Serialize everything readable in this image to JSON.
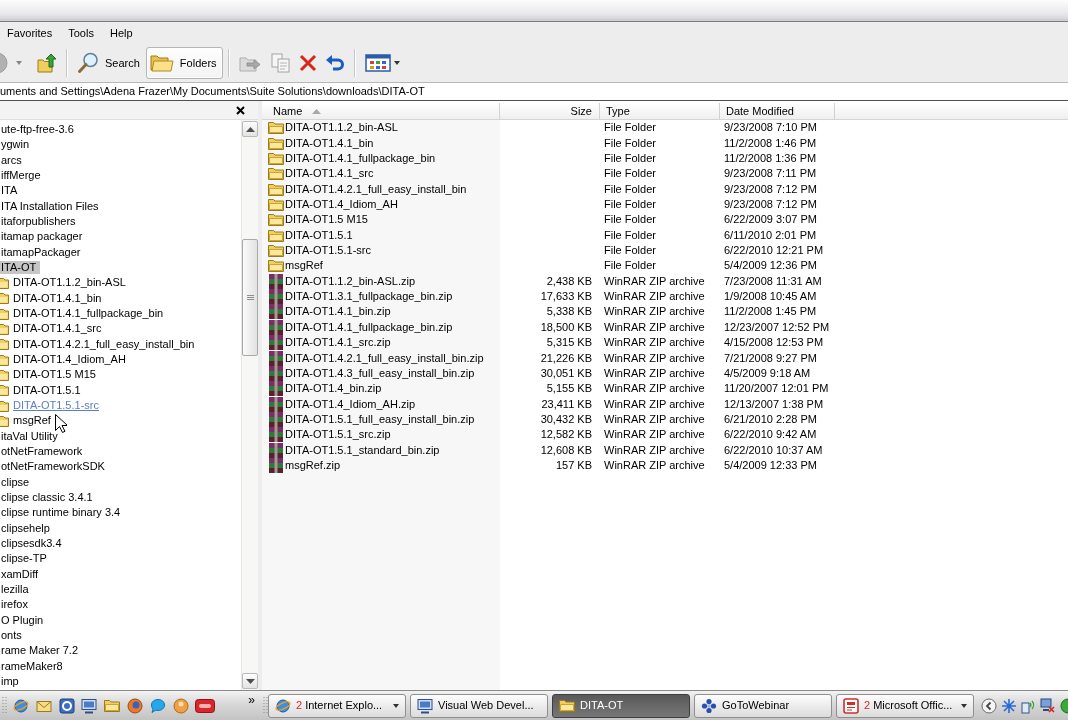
{
  "menu": [
    "Favorites",
    "Tools",
    "Help"
  ],
  "toolbar": [
    {
      "kind": "back",
      "disabled": true,
      "selected": false
    },
    {
      "kind": "history",
      "disabled": true,
      "selected": false
    },
    {
      "kind": "up",
      "disabled": false,
      "selected": false
    },
    {
      "kind": "search",
      "label": "Search",
      "disabled": false,
      "selected": false
    },
    {
      "kind": "folders",
      "label": "Folders",
      "disabled": false,
      "selected": true
    },
    {
      "kind": "move",
      "disabled": true,
      "selected": false
    },
    {
      "kind": "copy",
      "disabled": true,
      "selected": false
    },
    {
      "kind": "delete",
      "disabled": false,
      "selected": false
    },
    {
      "kind": "undo",
      "disabled": false,
      "selected": false
    },
    {
      "kind": "views",
      "disabled": false,
      "selected": false
    }
  ],
  "address": {
    "value": "uments and Settings\\Adena Frazer\\My Documents\\Suite Solutions\\downloads\\DITA-OT"
  },
  "folder_tree": {
    "items": [
      {
        "label": "ute-ftp-free-3.6",
        "selected": false
      },
      {
        "label": "ygwin",
        "selected": false
      },
      {
        "label": "arcs",
        "selected": false
      },
      {
        "label": "iffMerge",
        "selected": false
      },
      {
        "label": "ITA",
        "selected": false
      },
      {
        "label": "ITA Installation Files",
        "selected": false
      },
      {
        "label": "itaforpublishers",
        "selected": false
      },
      {
        "label": "itamap packager",
        "selected": false
      },
      {
        "label": "itamapPackager",
        "selected": false
      },
      {
        "label": "ITA-OT",
        "selected": true,
        "children": [
          {
            "label": "DITA-OT1.1.2_bin-ASL",
            "selected": false,
            "hovered": false
          },
          {
            "label": "DITA-OT1.4.1_bin",
            "selected": false,
            "hovered": false
          },
          {
            "label": "DITA-OT1.4.1_fullpackage_bin",
            "selected": false,
            "hovered": false
          },
          {
            "label": "DITA-OT1.4.1_src",
            "selected": false,
            "hovered": false
          },
          {
            "label": "DITA-OT1.4.2.1_full_easy_install_bin",
            "selected": false,
            "hovered": false
          },
          {
            "label": "DITA-OT1.4_Idiom_AH",
            "selected": false,
            "hovered": false
          },
          {
            "label": "DITA-OT1.5 M15",
            "selected": false,
            "hovered": false
          },
          {
            "label": "DITA-OT1.5.1",
            "selected": false,
            "hovered": false
          },
          {
            "label": "DITA-OT1.5.1-src",
            "selected": false,
            "hovered": true
          },
          {
            "label": "msgRef",
            "selected": false,
            "hovered": false
          }
        ]
      },
      {
        "label": "itaVal Utility",
        "selected": false
      },
      {
        "label": "otNetFramework",
        "selected": false
      },
      {
        "label": "otNetFrameworkSDK",
        "selected": false
      },
      {
        "label": "clipse",
        "selected": false
      },
      {
        "label": "clipse classic 3.4.1",
        "selected": false
      },
      {
        "label": "clipse runtime binary 3.4",
        "selected": false
      },
      {
        "label": "clipsehelp",
        "selected": false
      },
      {
        "label": "clipsesdk3.4",
        "selected": false
      },
      {
        "label": "clipse-TP",
        "selected": false
      },
      {
        "label": "xamDiff",
        "selected": false
      },
      {
        "label": "lezilla",
        "selected": false
      },
      {
        "label": "irefox",
        "selected": false
      },
      {
        "label": "O Plugin",
        "selected": false
      },
      {
        "label": "onts",
        "selected": false
      },
      {
        "label": "rame Maker 7.2",
        "selected": false
      },
      {
        "label": "rameMaker8",
        "selected": false
      },
      {
        "label": "imp",
        "selected": false
      }
    ]
  },
  "file_list": {
    "columns": [
      {
        "label": "Name",
        "sorted": true
      },
      {
        "label": "Size",
        "sorted": false
      },
      {
        "label": "Type",
        "sorted": false
      },
      {
        "label": "Date Modified",
        "sorted": false
      }
    ],
    "rows": [
      {
        "kind": "folder",
        "name": "DITA-OT1.1.2_bin-ASL",
        "type": "File Folder",
        "date_modified": "9/23/2008 7:10 PM"
      },
      {
        "kind": "folder",
        "name": "DITA-OT1.4.1_bin",
        "type": "File Folder",
        "date_modified": "11/2/2008 1:46 PM"
      },
      {
        "kind": "folder",
        "name": "DITA-OT1.4.1_fullpackage_bin",
        "type": "File Folder",
        "date_modified": "11/2/2008 1:36 PM"
      },
      {
        "kind": "folder",
        "name": "DITA-OT1.4.1_src",
        "type": "File Folder",
        "date_modified": "9/23/2008 7:11 PM"
      },
      {
        "kind": "folder",
        "name": "DITA-OT1.4.2.1_full_easy_install_bin",
        "type": "File Folder",
        "date_modified": "9/23/2008 7:12 PM"
      },
      {
        "kind": "folder",
        "name": "DITA-OT1.4_Idiom_AH",
        "type": "File Folder",
        "date_modified": "9/23/2008 7:12 PM"
      },
      {
        "kind": "folder",
        "name": "DITA-OT1.5 M15",
        "type": "File Folder",
        "date_modified": "6/22/2009 3:07 PM"
      },
      {
        "kind": "folder",
        "name": "DITA-OT1.5.1",
        "type": "File Folder",
        "date_modified": "6/11/2010 2:01 PM"
      },
      {
        "kind": "folder",
        "name": "DITA-OT1.5.1-src",
        "type": "File Folder",
        "date_modified": "6/22/2010 12:21 PM"
      },
      {
        "kind": "folder",
        "name": "msgRef",
        "type": "File Folder",
        "date_modified": "5/4/2009 12:36 PM"
      },
      {
        "kind": "archive",
        "name": "DITA-OT1.1.2_bin-ASL.zip",
        "size": "2,438 KB",
        "type": "WinRAR ZIP archive",
        "date_modified": "7/23/2008 11:31 AM"
      },
      {
        "kind": "archive",
        "name": "DITA-OT1.3.1_fullpackage_bin.zip",
        "size": "17,633 KB",
        "type": "WinRAR ZIP archive",
        "date_modified": "1/9/2008 10:45 AM"
      },
      {
        "kind": "archive",
        "name": "DITA-OT1.4.1_bin.zip",
        "size": "5,338 KB",
        "type": "WinRAR ZIP archive",
        "date_modified": "11/2/2008 1:45 PM"
      },
      {
        "kind": "archive",
        "name": "DITA-OT1.4.1_fullpackage_bin.zip",
        "size": "18,500 KB",
        "type": "WinRAR ZIP archive",
        "date_modified": "12/23/2007 12:52 PM"
      },
      {
        "kind": "archive",
        "name": "DITA-OT1.4.1_src.zip",
        "size": "5,315 KB",
        "type": "WinRAR ZIP archive",
        "date_modified": "4/15/2008 12:53 PM"
      },
      {
        "kind": "archive",
        "name": "DITA-OT1.4.2.1_full_easy_install_bin.zip",
        "size": "21,226 KB",
        "type": "WinRAR ZIP archive",
        "date_modified": "7/21/2008 9:27 PM"
      },
      {
        "kind": "archive",
        "name": "DITA-OT1.4.3_full_easy_install_bin.zip",
        "size": "30,051 KB",
        "type": "WinRAR ZIP archive",
        "date_modified": "4/5/2009 9:18 AM"
      },
      {
        "kind": "archive",
        "name": "DITA-OT1.4_bin.zip",
        "size": "5,155 KB",
        "type": "WinRAR ZIP archive",
        "date_modified": "11/20/2007 12:01 PM"
      },
      {
        "kind": "archive",
        "name": "DITA-OT1.4_Idiom_AH.zip",
        "size": "23,411 KB",
        "type": "WinRAR ZIP archive",
        "date_modified": "12/13/2007 1:38 PM"
      },
      {
        "kind": "archive",
        "name": "DITA-OT1.5.1_full_easy_install_bin.zip",
        "size": "30,432 KB",
        "type": "WinRAR ZIP archive",
        "date_modified": "6/21/2010 2:28 PM"
      },
      {
        "kind": "archive",
        "name": "DITA-OT1.5.1_src.zip",
        "size": "12,582 KB",
        "type": "WinRAR ZIP archive",
        "date_modified": "6/22/2010 9:42 AM"
      },
      {
        "kind": "archive",
        "name": "DITA-OT1.5.1_standard_bin.zip",
        "size": "12,608 KB",
        "type": "WinRAR ZIP archive",
        "date_modified": "6/22/2010 10:37 AM"
      },
      {
        "kind": "archive",
        "name": "msgRef.zip",
        "size": "157 KB",
        "type": "WinRAR ZIP archive",
        "date_modified": "5/4/2009 12:33 PM"
      }
    ]
  },
  "taskbar": {
    "quick_launch_more": "»",
    "buttons": [
      {
        "count": "2",
        "label": "Internet Explo...",
        "selected": false
      },
      {
        "label": "Visual Web Devel...",
        "selected": false
      },
      {
        "label": "DITA-OT",
        "selected": true
      },
      {
        "label": "GoToWebinar",
        "selected": false
      },
      {
        "count": "2",
        "label": "Microsoft Offic...",
        "selected": false
      }
    ]
  }
}
